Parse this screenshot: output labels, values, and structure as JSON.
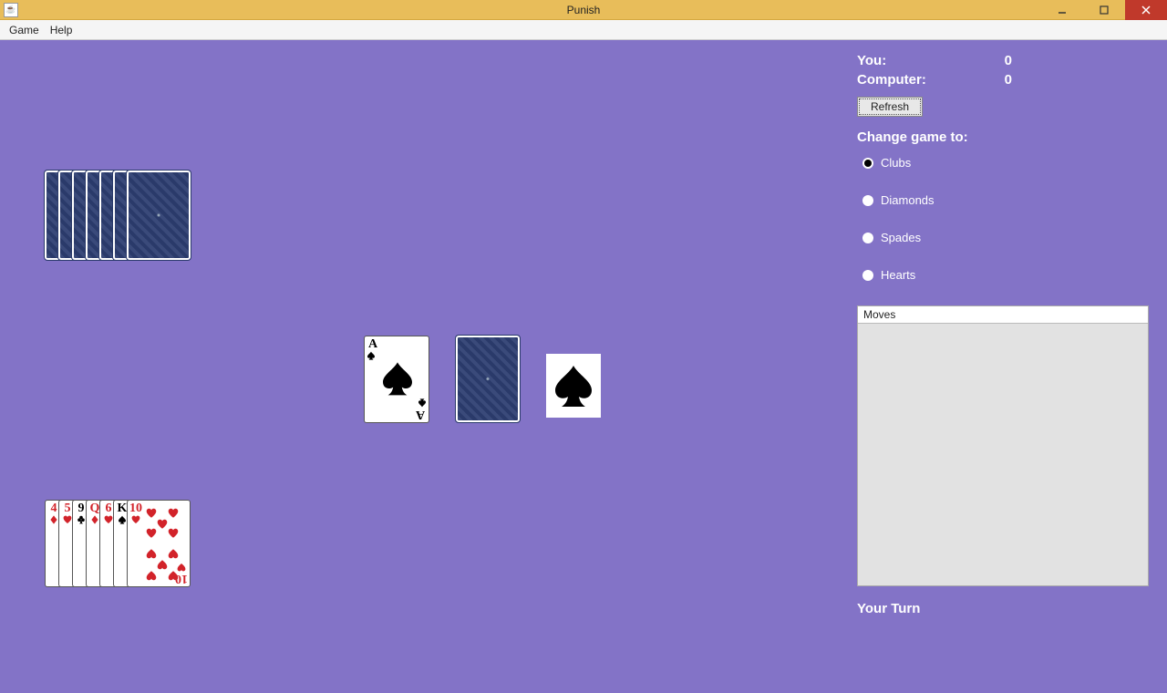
{
  "window": {
    "title": "Punish",
    "java_icon": "☕"
  },
  "menu": {
    "game": "Game",
    "help": "Help"
  },
  "panel": {
    "you_label": "You:",
    "you_score": "0",
    "computer_label": "Computer:",
    "computer_score": "0",
    "refresh": "Refresh",
    "change_label": "Change game to:",
    "suits": {
      "clubs": "Clubs",
      "diamonds": "Diamonds",
      "spades": "Spades",
      "hearts": "Hearts"
    },
    "selected_suit": "clubs",
    "moves_header": "Moves",
    "turn": "Your Turn"
  },
  "center": {
    "face_up": {
      "rank": "A",
      "suit": "spades"
    },
    "current_suit_indicator": "spades"
  },
  "opponent_hand_count": 7,
  "player_hand": [
    {
      "rank": "4",
      "suit": "diamonds",
      "color": "red"
    },
    {
      "rank": "5",
      "suit": "hearts",
      "color": "red"
    },
    {
      "rank": "9",
      "suit": "clubs",
      "color": "black"
    },
    {
      "rank": "Q",
      "suit": "diamonds",
      "color": "red"
    },
    {
      "rank": "6",
      "suit": "hearts",
      "color": "red"
    },
    {
      "rank": "K",
      "suit": "spades",
      "color": "black"
    },
    {
      "rank": "10",
      "suit": "hearts",
      "color": "red"
    }
  ]
}
